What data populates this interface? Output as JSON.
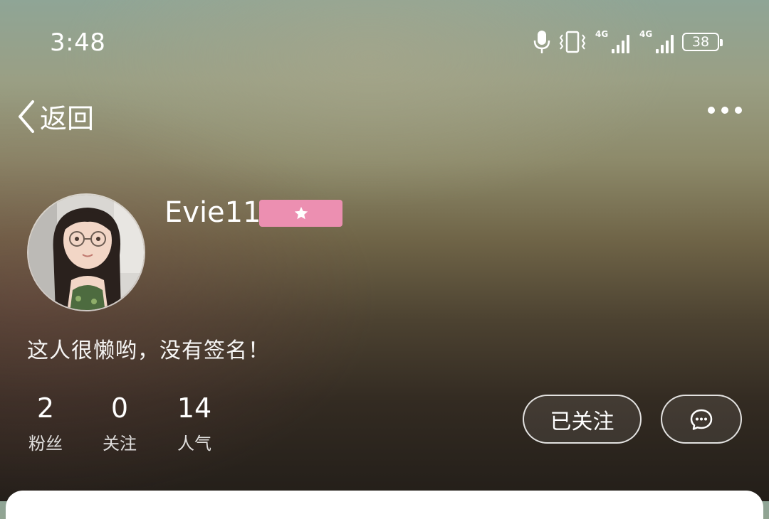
{
  "status_bar": {
    "time": "3:48",
    "network_1": "4G",
    "network_2": "4G",
    "battery": "38",
    "icons": [
      "microphone-icon",
      "vibrate-icon",
      "signal-icon",
      "signal-icon",
      "battery-icon"
    ]
  },
  "header": {
    "back_label": "返回",
    "more_icon": "more-dots-icon"
  },
  "profile": {
    "username": "Evie11",
    "badge_icon": "star-icon",
    "badge_color": "#ec8fb1",
    "signature": "这人很懒哟，没有签名！",
    "stats": [
      {
        "value": "2",
        "label": "粉丝"
      },
      {
        "value": "0",
        "label": "关注"
      },
      {
        "value": "14",
        "label": "人气"
      }
    ]
  },
  "actions": {
    "follow_label": "已关注",
    "message_icon": "chat-bubble-icon"
  }
}
